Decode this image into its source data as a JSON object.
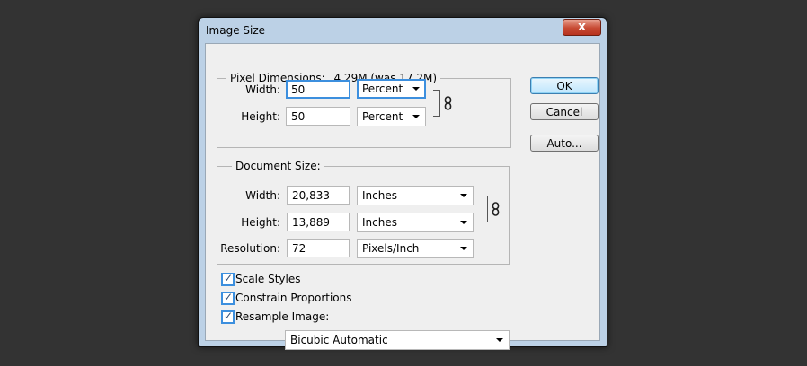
{
  "window": {
    "title": "Image Size",
    "close_label": "x"
  },
  "pixel_dimensions": {
    "label": "Pixel Dimensions:",
    "summary": "4,29M (was 17,2M)",
    "width_label": "Width:",
    "width_value": "50",
    "width_unit": "Percent",
    "height_label": "Height:",
    "height_value": "50",
    "height_unit": "Percent"
  },
  "document_size": {
    "label": "Document Size:",
    "width_label": "Width:",
    "width_value": "20,833",
    "width_unit": "Inches",
    "height_label": "Height:",
    "height_value": "13,889",
    "height_unit": "Inches",
    "resolution_label": "Resolution:",
    "resolution_value": "72",
    "resolution_unit": "Pixels/Inch"
  },
  "options": {
    "scale_styles": {
      "label": "Scale Styles",
      "checked": true
    },
    "constrain_proportions": {
      "label": "Constrain Proportions",
      "checked": true
    },
    "resample_image": {
      "label": "Resample Image:",
      "checked": true
    },
    "resample_method": "Bicubic Automatic"
  },
  "buttons": {
    "ok": "OK",
    "cancel": "Cancel",
    "auto": "Auto..."
  },
  "colors": {
    "focus_blue": "#3c8fde",
    "desktop": "#333333",
    "dialog_bg": "#efefef"
  },
  "icons": {
    "link": "chain-link-icon",
    "dropdown": "chevron-down-icon"
  }
}
